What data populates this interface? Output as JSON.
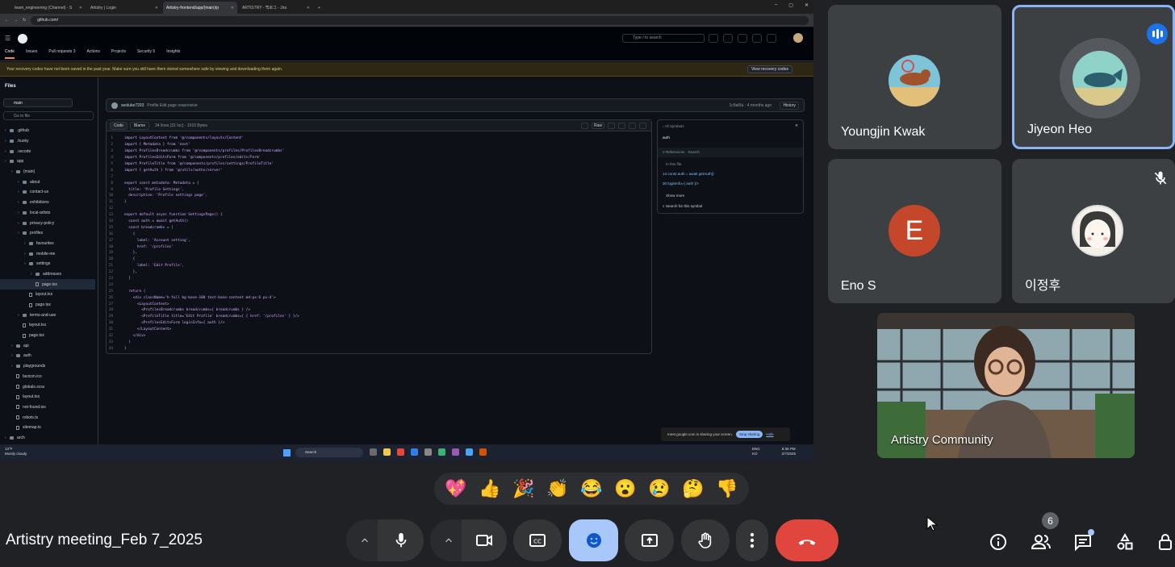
{
  "browser": {
    "tabs": [
      {
        "label": "team_engineering (Channel) - S",
        "active": false
      },
      {
        "label": "Artistry | Login",
        "active": false
      },
      {
        "label": "Artistry-frontend/app/(main)/p",
        "active": true
      },
      {
        "label": "ARTISTRY - 백로그 - Jira",
        "active": false
      }
    ],
    "url": "github.com/"
  },
  "github": {
    "search_placeholder": "Type / to search",
    "nav": [
      {
        "label": "Code",
        "count": ""
      },
      {
        "label": "Issues",
        "count": ""
      },
      {
        "label": "Pull requests",
        "count": "3"
      },
      {
        "label": "Actions",
        "count": ""
      },
      {
        "label": "Projects",
        "count": ""
      },
      {
        "label": "Security",
        "count": "5"
      },
      {
        "label": "Insights",
        "count": ""
      }
    ],
    "warning": "Your recovery codes have not been saved in the past year. Make sure you still have them stored somewhere safe by viewing and downloading them again.",
    "warning_button": "View recovery codes",
    "files_title": "Files",
    "branch": "main",
    "goto_placeholder": "Go to file",
    "tree": [
      {
        "label": ".github",
        "type": "folder",
        "indent": 0
      },
      {
        "label": ".husky",
        "type": "folder",
        "indent": 0
      },
      {
        "label": ".vscode",
        "type": "folder",
        "indent": 0
      },
      {
        "label": "app",
        "type": "folder",
        "indent": 0
      },
      {
        "label": "(main)",
        "type": "folder",
        "indent": 1
      },
      {
        "label": "about",
        "type": "folder",
        "indent": 2
      },
      {
        "label": "contact-us",
        "type": "folder",
        "indent": 2
      },
      {
        "label": "exhibitions",
        "type": "folder",
        "indent": 2
      },
      {
        "label": "local-artists",
        "type": "folder",
        "indent": 2
      },
      {
        "label": "privacy-policy",
        "type": "folder",
        "indent": 2
      },
      {
        "label": "profiles",
        "type": "folder",
        "indent": 2
      },
      {
        "label": "favourites",
        "type": "folder",
        "indent": 3
      },
      {
        "label": "mobile-me",
        "type": "folder",
        "indent": 3
      },
      {
        "label": "settings",
        "type": "folder",
        "indent": 3
      },
      {
        "label": "addresses",
        "type": "folder",
        "indent": 4
      },
      {
        "label": "page.tsx",
        "type": "file",
        "indent": 4,
        "selected": true
      },
      {
        "label": "layout.tsx",
        "type": "file",
        "indent": 3
      },
      {
        "label": "page.tsx",
        "type": "file",
        "indent": 3
      },
      {
        "label": "terms-and-use",
        "type": "folder",
        "indent": 2
      },
      {
        "label": "layout.tsx",
        "type": "file",
        "indent": 2
      },
      {
        "label": "page.tsx",
        "type": "file",
        "indent": 2
      },
      {
        "label": "api",
        "type": "folder",
        "indent": 1
      },
      {
        "label": "auth",
        "type": "folder",
        "indent": 1
      },
      {
        "label": "playgrounds",
        "type": "folder",
        "indent": 1
      },
      {
        "label": "favicon.ico",
        "type": "file",
        "indent": 1
      },
      {
        "label": "globals.scss",
        "type": "file",
        "indent": 1
      },
      {
        "label": "layout.tsx",
        "type": "file",
        "indent": 1
      },
      {
        "label": "not-found.tsx",
        "type": "file",
        "indent": 1
      },
      {
        "label": "robots.ts",
        "type": "file",
        "indent": 1
      },
      {
        "label": "sitemap.ts",
        "type": "file",
        "indent": 1
      },
      {
        "label": "arch",
        "type": "folder",
        "indent": 0
      }
    ],
    "commit": {
      "author": "seoluke7203",
      "message": "Profile Edit page responsive",
      "meta": "1c9a6fa · 4 months ago",
      "history": "History"
    },
    "code_tabs": [
      "Code",
      "Blame"
    ],
    "code_info": "34 lines (31 loc) · 1010 Bytes",
    "raw": "Raw",
    "code_lines": [
      "import LayoutContent from '@/components/layouts/Content'",
      "import { Metadata } from 'next'",
      "import ProfilesBreadcrumbs from '@/components/profiles/ProfilesBreadcrumbs'",
      "import ProfilesEditsForm from '@/components/profiles/edits/Form'",
      "import ProfileTitle from '@/components/profiles/settings/ProfileTitle'",
      "import { getAuth } from '@/utils/auths/server'",
      "",
      "export const metadata: Metadata = {",
      "  title: 'Profile Settings',",
      "  description: 'Profile settings page',",
      "}",
      "",
      "export default async function SettingsPage() {",
      "  const auth = await getAuth()",
      "  const breadcrumbs = [",
      "    {",
      "      label: 'Account setting',",
      "      href: '/profiles'",
      "    },",
      "    {",
      "      label: 'Edit Profile',",
      "    },",
      "  ]",
      "",
      "  return (",
      "    <div className='h-full bg-base-100 text-base-content md:px-6 px-4'>",
      "      <LayoutContent>",
      "        <ProfilesBreadcrumbs breadcrumbs={ breadcrumbs } />",
      "        <ProfileTitle title='Edit Profile' breadcrumbs={ { href: '/profiles' } }/>",
      "        <ProfilesEditsForm loginInfo={ auth }/>",
      "      </LayoutContent>",
      "    </div>",
      "  )",
      "}"
    ],
    "symbols": {
      "title": "All Symbols",
      "query": "auth",
      "references": "2 References",
      "search": "Search",
      "in_file": "In this file",
      "refs": [
        "14  const auth = await getAuth()",
        "30  loginInfo={ auth }/>"
      ],
      "show_more": "Show more",
      "search_symbol": "Search for this symbol"
    }
  },
  "share_banner": {
    "text": "meet.google.com is sharing your screen.",
    "stop": "Stop sharing",
    "hide": "Hide"
  },
  "taskbar": {
    "weather_temp": "13°F",
    "weather_desc": "Mostly cloudy",
    "search": "Search",
    "lang1": "ENG",
    "lang2": "KO",
    "time": "8:36 PM",
    "date": "2/7/2025"
  },
  "participants": [
    {
      "name": "Youngjin Kwak",
      "speaking": false,
      "muted": false
    },
    {
      "name": "Jiyeon Heo",
      "speaking": true,
      "muted": false
    },
    {
      "name": "Eno S",
      "initial": "E",
      "muted": false
    },
    {
      "name": "이정후",
      "muted": true
    }
  ],
  "video_tile_name": "Artistry Community",
  "reactions": [
    "💖",
    "👍",
    "🎉",
    "👏",
    "😂",
    "😮",
    "😢",
    "🤔",
    "👎"
  ],
  "meeting_title": "Artistry meeting_Feb 7_2025",
  "people_count": "6",
  "colors": {
    "end_call": "#e0463e",
    "reaction_active": "#a8c7fa",
    "speaking": "#1a73e8",
    "eno_avatar": "#c5472b"
  }
}
